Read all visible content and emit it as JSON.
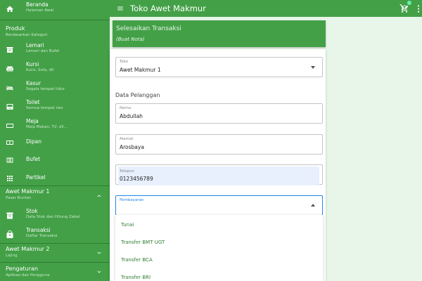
{
  "topbar": {
    "title": "Toko Awet Makmur"
  },
  "sidebar": {
    "home": {
      "label": "Beranda",
      "sub": "Halaman Awal"
    },
    "produk": {
      "label": "Produk",
      "sub": "Berdasarkan Kategori"
    },
    "items": [
      {
        "label": "Lemari",
        "sub": "Lemari dan Bufet"
      },
      {
        "label": "Kursi",
        "sub": "Kursi, Sofa, dll"
      },
      {
        "label": "Kasur",
        "sub": "Segala tempat tidur"
      },
      {
        "label": "Toilet",
        "sub": "Semua tempat rias"
      },
      {
        "label": "Meja",
        "sub": "Meja Makan, TV, dll..."
      },
      {
        "label": "Dipan",
        "sub": ""
      },
      {
        "label": "Bufet",
        "sub": ""
      },
      {
        "label": "Partikel",
        "sub": ""
      }
    ],
    "store1": {
      "label": "Awet Makmur 1",
      "sub": "Pasar Bunten"
    },
    "store1_items": [
      {
        "label": "Stok",
        "sub": "Data Stok dan Hitung Zakat"
      },
      {
        "label": "Transaksi",
        "sub": "Daftar Transaksi"
      }
    ],
    "store2": {
      "label": "Awet Makmur 2",
      "sub": "Lajing"
    },
    "settings": {
      "label": "Pengaturan",
      "sub": "Aplikasi dan Pengguna"
    }
  },
  "page": {
    "title": "Selesaikan Transaksi",
    "subtitle": "(Buat Nota)"
  },
  "form": {
    "toko": {
      "label": "Toko",
      "value": "Awet Makmur 1"
    },
    "customer_section": "Data Pelanggan",
    "nama": {
      "label": "Nama",
      "value": "Abdullah"
    },
    "alamat": {
      "label": "Alamat",
      "value": "Arosbaya"
    },
    "telepon": {
      "label": "Telepon",
      "value": "0123456789"
    },
    "pembayaran": {
      "label": "Pembayaran",
      "value": ""
    },
    "payment_options": [
      "Tunai",
      "Transfer BMT UGT",
      "Transfer BCA",
      "Transfer BRI"
    ]
  },
  "colors": {
    "primary": "#43a047",
    "accent": "#69f0ae",
    "focus": "#1e88e5",
    "background": "#e8f5e9"
  }
}
